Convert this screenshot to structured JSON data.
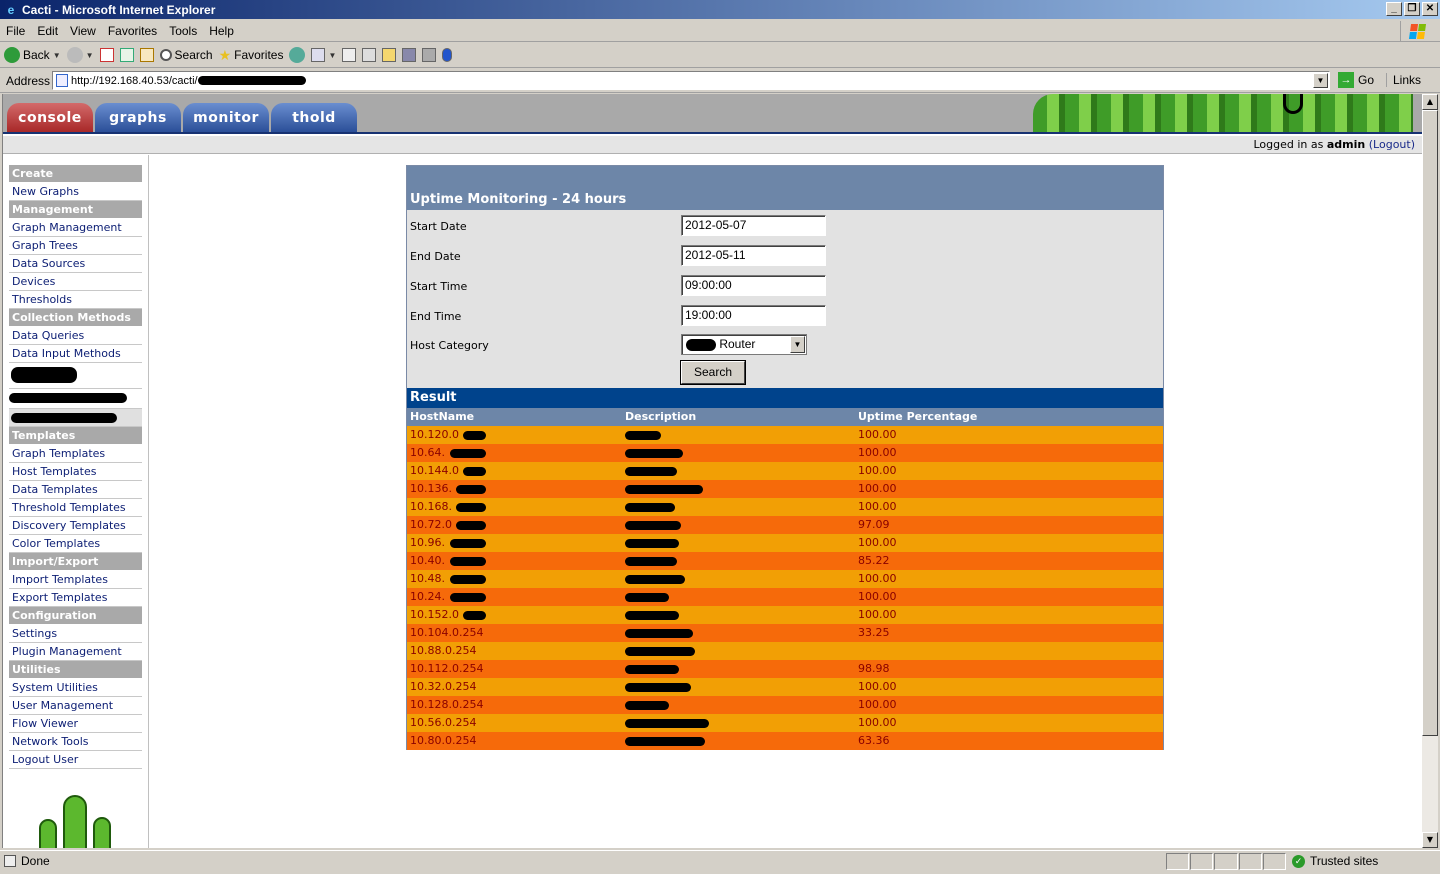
{
  "window": {
    "title": "Cacti - Microsoft Internet Explorer"
  },
  "menu": [
    "File",
    "Edit",
    "View",
    "Favorites",
    "Tools",
    "Help"
  ],
  "toolbar": {
    "back": "Back",
    "search": "Search",
    "favorites": "Favorites"
  },
  "address": {
    "label": "Address",
    "url": "http://192.168.40.53/cacti/",
    "go": "Go",
    "links": "Links"
  },
  "tabs": [
    "console",
    "graphs",
    "monitor",
    "thold"
  ],
  "login": {
    "prefix": "Logged in as",
    "user": "admin",
    "logout": "(Logout)"
  },
  "sidebar": {
    "create": "Create",
    "new_graphs": "New Graphs",
    "management": "Management",
    "management_items": [
      "Graph Management",
      "Graph Trees",
      "Data Sources",
      "Devices",
      "Thresholds"
    ],
    "collection": "Collection Methods",
    "collection_items": [
      "Data Queries",
      "Data Input Methods"
    ],
    "templates": "Templates",
    "templates_items": [
      "Graph Templates",
      "Host Templates",
      "Data Templates",
      "Threshold Templates",
      "Discovery Templates",
      "Color Templates"
    ],
    "import_export": "Import/Export",
    "import_export_items": [
      "Import Templates",
      "Export Templates"
    ],
    "configuration": "Configuration",
    "configuration_items": [
      "Settings",
      "Plugin Management"
    ],
    "utilities": "Utilities",
    "utilities_items": [
      "System Utilities",
      "User Management",
      "Flow Viewer",
      "Network Tools",
      "Logout User"
    ]
  },
  "form": {
    "title": "Uptime Monitoring - 24 hours",
    "start_date_label": "Start Date",
    "start_date": "2012-05-07",
    "end_date_label": "End Date",
    "end_date": "2012-05-11",
    "start_time_label": "Start Time",
    "start_time": "09:00:00",
    "end_time_label": "End Time",
    "end_time": "19:00:00",
    "category_label": "Host Category",
    "category": "Router",
    "search": "Search"
  },
  "result": {
    "title": "Result",
    "columns": [
      "HostName",
      "Description",
      "Uptime Percentage"
    ],
    "rows": [
      {
        "host": "10.120.0",
        "uptime": "100.00"
      },
      {
        "host": "10.64.",
        "uptime": "100.00"
      },
      {
        "host": "10.144.0",
        "uptime": "100.00"
      },
      {
        "host": "10.136.",
        "uptime": "100.00"
      },
      {
        "host": "10.168.",
        "uptime": "100.00"
      },
      {
        "host": "10.72.0",
        "uptime": "97.09"
      },
      {
        "host": "10.96.",
        "uptime": "100.00"
      },
      {
        "host": "10.40.",
        "uptime": "85.22"
      },
      {
        "host": "10.48.",
        "uptime": "100.00"
      },
      {
        "host": "10.24.",
        "uptime": "100.00"
      },
      {
        "host": "10.152.0",
        "uptime": "100.00"
      },
      {
        "host": "10.104.0.254",
        "uptime": "33.25"
      },
      {
        "host": "10.88.0.254",
        "uptime": ""
      },
      {
        "host": "10.112.0.254",
        "uptime": "98.98"
      },
      {
        "host": "10.32.0.254",
        "uptime": "100.00"
      },
      {
        "host": "10.128.0.254",
        "uptime": "100.00"
      },
      {
        "host": "10.56.0.254",
        "uptime": "100.00"
      },
      {
        "host": "10.80.0.254",
        "uptime": "63.36"
      }
    ]
  },
  "status": {
    "left": "Done",
    "zone": "Trusted sites"
  },
  "colors": {
    "title_bar": "#0a246a",
    "odd_row": "#f29f05",
    "even_row": "#f66a0a",
    "result_header": "#00438c"
  }
}
